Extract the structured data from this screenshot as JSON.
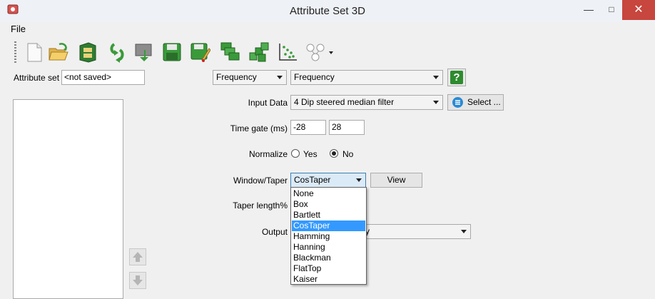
{
  "window": {
    "title": "Attribute Set 3D",
    "close_glyph": "✕",
    "minimize_glyph": "—",
    "maximize_glyph": "□"
  },
  "menu": {
    "file": "File"
  },
  "toolbar": {
    "icons": [
      "new-icon",
      "open-icon",
      "save-set-icon",
      "reload-icon",
      "import-icon",
      "save-icon",
      "save-as-icon",
      "default-sets-icon",
      "evaluate-icon",
      "crossplot-icon",
      "graph-icon"
    ]
  },
  "attribute_set": {
    "label": "Attribute set",
    "value": "<not saved>"
  },
  "type_combo": {
    "value": "Frequency"
  },
  "attribute_combo": {
    "value": "Frequency"
  },
  "help_glyph": "?",
  "input_data": {
    "label": "Input Data",
    "value": "4 Dip steered median filter",
    "select_label": "Select ..."
  },
  "time_gate": {
    "label": "Time gate (ms)",
    "start": "-28",
    "stop": "28"
  },
  "normalize": {
    "label": "Normalize",
    "yes": "Yes",
    "no": "No",
    "selected": "No"
  },
  "window_taper": {
    "label": "Window/Taper",
    "value": "CosTaper",
    "view_label": "View",
    "options": [
      "None",
      "Box",
      "Bartlett",
      "CosTaper",
      "Hamming",
      "Hanning",
      "Blackman",
      "FlatTop",
      "Kaiser"
    ]
  },
  "taper_length": {
    "label": "Taper length%"
  },
  "output": {
    "label": "Output",
    "partial_value": "y"
  },
  "colors": {
    "accent": "#3399ff",
    "close": "#c7463e",
    "help_green": "#2e8b2e"
  }
}
